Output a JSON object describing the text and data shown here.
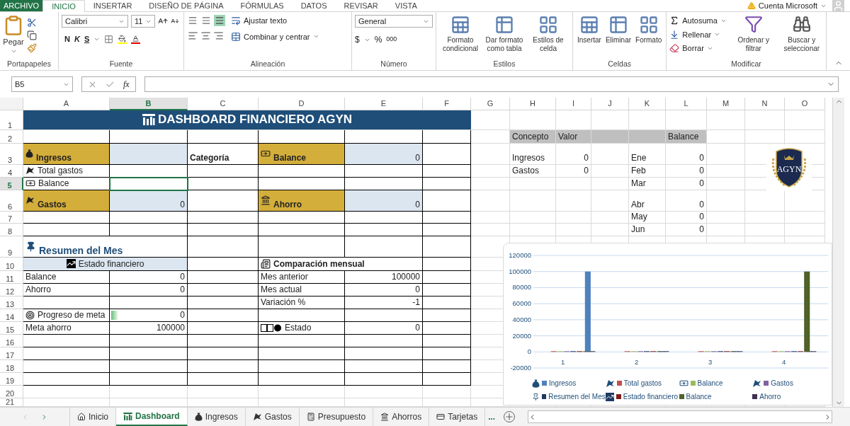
{
  "ribbon": {
    "tabs": [
      {
        "label": "ARCHIVO",
        "kind": "file",
        "selected": false
      },
      {
        "label": "INICIO",
        "kind": "tab",
        "selected": true
      },
      {
        "label": "INSERTAR",
        "kind": "tab",
        "selected": false
      },
      {
        "label": "DISEÑO DE PÁGINA",
        "kind": "tab",
        "selected": false
      },
      {
        "label": "FÓRMULAS",
        "kind": "tab",
        "selected": false
      },
      {
        "label": "DATOS",
        "kind": "tab",
        "selected": false
      },
      {
        "label": "REVISAR",
        "kind": "tab",
        "selected": false
      },
      {
        "label": "VISTA",
        "kind": "tab",
        "selected": false
      }
    ],
    "account": "Cuenta Microsoft",
    "groups": [
      {
        "kind": "clipboard",
        "name": "Portapapeles",
        "paste": "Pegar"
      },
      {
        "kind": "font",
        "name": "Fuente",
        "font": "Calibri",
        "size": "11",
        "bold": "N",
        "italic": "K",
        "underline": "S"
      },
      {
        "kind": "alignment",
        "name": "Alineación",
        "wrap": "Ajustar texto",
        "merge": "Combinar y centrar",
        "vertical": [
          {
            "selected": false
          },
          {
            "selected": false
          },
          {
            "selected": true
          }
        ]
      },
      {
        "kind": "number",
        "name": "Número",
        "format": "General",
        "currency": "$",
        "percent": "%",
        "thousands": "000"
      },
      {
        "kind": "large",
        "name": "Estilos",
        "buttons": [
          "Formato condicional",
          "Dar formato como tabla",
          "Estilos de celda"
        ]
      },
      {
        "kind": "large",
        "name": "Celdas",
        "buttons": [
          "Insertar",
          "Eliminar",
          "Formato"
        ]
      },
      {
        "kind": "editing",
        "name": "Modificar",
        "small": [
          "Autosuma",
          "Rellenar",
          "Borrar"
        ],
        "large": [
          "Ordenar y filtrar",
          "Buscar y seleccionar"
        ]
      }
    ]
  },
  "formula_bar": {
    "name_box": "B5",
    "function_label": "fx"
  },
  "sheet": {
    "columns": [
      {
        "label": "A",
        "selected": false
      },
      {
        "label": "B",
        "selected": true
      },
      {
        "label": "C",
        "selected": false
      },
      {
        "label": "D",
        "selected": false
      },
      {
        "label": "E",
        "selected": false
      },
      {
        "label": "F",
        "selected": false
      },
      {
        "label": "G",
        "selected": false
      },
      {
        "label": "H",
        "selected": false
      },
      {
        "label": "I",
        "selected": false
      },
      {
        "label": "J",
        "selected": false
      },
      {
        "label": "K",
        "selected": false
      },
      {
        "label": "L",
        "selected": false
      },
      {
        "label": "M",
        "selected": false
      },
      {
        "label": "N",
        "selected": false
      },
      {
        "label": "O",
        "selected": false
      }
    ],
    "rows": [
      {
        "label": "1",
        "selected": false,
        "cells": [
          {
            "kind": "title",
            "text": "DASHBOARD FINANCIERO AGYN"
          },
          {
            "kind": "merged"
          },
          {
            "kind": "merged"
          },
          {
            "kind": "merged"
          },
          {
            "kind": "merged"
          },
          {
            "kind": "merged"
          }
        ]
      },
      {
        "label": "2",
        "selected": false,
        "cells": [
          {
            "kind": "empty"
          },
          {
            "kind": "empty"
          },
          {
            "kind": "empty"
          },
          {
            "kind": "empty"
          },
          {
            "kind": "empty"
          },
          {
            "kind": "empty"
          },
          {
            "kind": "empty"
          },
          {
            "kind": "gray",
            "text": "Concepto"
          },
          {
            "kind": "gray",
            "text": "Valor"
          },
          {
            "kind": "gray"
          },
          {
            "kind": "gray"
          },
          {
            "kind": "gray",
            "text": "Balance"
          }
        ]
      },
      {
        "label": "3",
        "selected": false,
        "cells": [
          {
            "kind": "gold",
            "text": "Ingresos"
          },
          {
            "kind": "blue"
          },
          {
            "kind": "bold",
            "text": "Categoría"
          },
          {
            "kind": "gold",
            "text": "Balance"
          },
          {
            "kind": "blue",
            "text": "0"
          },
          {
            "kind": "empty"
          },
          {
            "kind": "empty"
          },
          {
            "kind": "label",
            "text": "Ingresos"
          },
          {
            "kind": "number",
            "text": "0"
          },
          {
            "kind": "empty"
          },
          {
            "kind": "label",
            "text": "Ene"
          },
          {
            "kind": "number",
            "text": "0"
          }
        ]
      },
      {
        "label": "4",
        "selected": false,
        "cells": [
          {
            "kind": "label",
            "text": "Total gastos"
          },
          {
            "kind": "empty"
          },
          {
            "kind": "empty"
          },
          {
            "kind": "empty"
          },
          {
            "kind": "empty"
          },
          {
            "kind": "empty"
          },
          {
            "kind": "empty"
          },
          {
            "kind": "label",
            "text": "Gastos"
          },
          {
            "kind": "number",
            "text": "0"
          },
          {
            "kind": "empty"
          },
          {
            "kind": "label",
            "text": "Feb"
          },
          {
            "kind": "number",
            "text": "0"
          }
        ]
      },
      {
        "label": "5",
        "selected": true,
        "cells": [
          {
            "kind": "label",
            "text": "Balance"
          },
          {
            "kind": "empty"
          },
          {
            "kind": "empty"
          },
          {
            "kind": "empty"
          },
          {
            "kind": "empty"
          },
          {
            "kind": "empty"
          },
          {
            "kind": "empty"
          },
          {
            "kind": "empty"
          },
          {
            "kind": "empty"
          },
          {
            "kind": "empty"
          },
          {
            "kind": "label",
            "text": "Mar"
          },
          {
            "kind": "number",
            "text": "0"
          }
        ]
      },
      {
        "label": "6",
        "selected": false,
        "cells": [
          {
            "kind": "gold",
            "text": "Gastos"
          },
          {
            "kind": "blue",
            "text": "0"
          },
          {
            "kind": "empty"
          },
          {
            "kind": "gold",
            "text": "Ahorro"
          },
          {
            "kind": "blue",
            "text": "0"
          },
          {
            "kind": "empty"
          },
          {
            "kind": "empty"
          },
          {
            "kind": "empty"
          },
          {
            "kind": "empty"
          },
          {
            "kind": "empty"
          },
          {
            "kind": "label",
            "text": "Abr"
          },
          {
            "kind": "number",
            "text": "0"
          }
        ]
      },
      {
        "label": "7",
        "selected": false,
        "cells": [
          {
            "kind": "empty"
          },
          {
            "kind": "empty"
          },
          {
            "kind": "empty"
          },
          {
            "kind": "empty"
          },
          {
            "kind": "empty"
          },
          {
            "kind": "empty"
          },
          {
            "kind": "empty"
          },
          {
            "kind": "empty"
          },
          {
            "kind": "empty"
          },
          {
            "kind": "empty"
          },
          {
            "kind": "label",
            "text": "May"
          },
          {
            "kind": "number",
            "text": "0"
          }
        ]
      },
      {
        "label": "8",
        "selected": false,
        "cells": [
          {
            "kind": "empty"
          },
          {
            "kind": "empty"
          },
          {
            "kind": "empty"
          },
          {
            "kind": "empty"
          },
          {
            "kind": "empty"
          },
          {
            "kind": "empty"
          },
          {
            "kind": "empty"
          },
          {
            "kind": "empty"
          },
          {
            "kind": "empty"
          },
          {
            "kind": "empty"
          },
          {
            "kind": "label",
            "text": "Jun"
          },
          {
            "kind": "number",
            "text": "0"
          }
        ]
      },
      {
        "label": "9",
        "selected": false,
        "cells": [
          {
            "kind": "section",
            "text": "Resumen del Mes"
          },
          {
            "kind": "merged"
          }
        ]
      },
      {
        "label": "10",
        "selected": false,
        "cells": [
          {
            "kind": "subheader",
            "text": "Estado financiero"
          },
          {
            "kind": "merged"
          },
          {
            "kind": "empty"
          },
          {
            "kind": "bold",
            "text": "Comparación mensual"
          },
          {
            "kind": "merged"
          }
        ]
      },
      {
        "label": "11",
        "selected": false,
        "cells": [
          {
            "kind": "label",
            "text": "Balance"
          },
          {
            "kind": "number",
            "text": "0"
          },
          {
            "kind": "empty"
          },
          {
            "kind": "label",
            "text": "Mes anterior"
          },
          {
            "kind": "number",
            "text": "100000"
          }
        ]
      },
      {
        "label": "12",
        "selected": false,
        "cells": [
          {
            "kind": "label",
            "text": "Ahorro"
          },
          {
            "kind": "number",
            "text": "0"
          },
          {
            "kind": "empty"
          },
          {
            "kind": "label",
            "text": "Mes actual"
          },
          {
            "kind": "number",
            "text": "0"
          }
        ]
      },
      {
        "label": "13",
        "selected": false,
        "cells": [
          {
            "kind": "empty"
          },
          {
            "kind": "empty"
          },
          {
            "kind": "empty"
          },
          {
            "kind": "label",
            "text": "Variación %"
          },
          {
            "kind": "number",
            "text": "-1"
          }
        ]
      },
      {
        "label": "14",
        "selected": false,
        "cells": [
          {
            "kind": "label",
            "text": "Progreso de meta"
          },
          {
            "kind": "databar",
            "text": "0",
            "level": 0
          }
        ]
      },
      {
        "label": "15",
        "selected": false,
        "cells": [
          {
            "kind": "label",
            "text": "Meta ahorro"
          },
          {
            "kind": "number",
            "text": "100000"
          },
          {
            "kind": "empty"
          },
          {
            "kind": "label",
            "text": "Estado"
          },
          {
            "kind": "number",
            "text": "0"
          }
        ]
      },
      {
        "label": "16",
        "selected": false
      },
      {
        "label": "17",
        "selected": false
      },
      {
        "label": "18",
        "selected": false
      },
      {
        "label": "19",
        "selected": false
      },
      {
        "label": "20",
        "selected": false
      },
      {
        "label": "21",
        "selected": false
      }
    ],
    "logo": {
      "text": "AGYN"
    },
    "chart": {
      "chart_data": {
        "type": "bar",
        "categories": [
          "1",
          "2",
          "3",
          "4"
        ],
        "series": [
          {
            "name": "Ingresos",
            "color": "#4f81bd",
            "values": [
              100000,
              0,
              0,
              0
            ]
          },
          {
            "name": "Total gastos",
            "color": "#c0504d",
            "values": [
              0,
              0,
              0,
              0
            ]
          },
          {
            "name": "Balance",
            "color": "#9bbb59",
            "values": [
              0,
              0,
              0,
              0
            ]
          },
          {
            "name": "Gastos",
            "color": "#8064a2",
            "values": [
              0,
              0,
              0,
              0
            ]
          },
          {
            "name": "Resumen del Mes",
            "color": "#1f3864",
            "values": [
              0,
              0,
              0,
              0
            ]
          },
          {
            "name": "Estado financiero",
            "color": "#7f1d1d",
            "values": [
              0,
              0,
              0,
              0
            ]
          },
          {
            "name": "Balance",
            "color": "#4f6228",
            "values": [
              0,
              0,
              0,
              100000
            ]
          },
          {
            "name": "Ahorro",
            "color": "#3f3151",
            "values": [
              0,
              0,
              0,
              0
            ]
          }
        ],
        "ylim": [
          -20000,
          120000
        ],
        "yticks": [
          -20000,
          0,
          20000,
          40000,
          60000,
          80000,
          100000,
          120000
        ],
        "grid": true,
        "legend": true
      }
    }
  },
  "sheet_tabs": {
    "tabs": [
      {
        "label": "Inicio",
        "selected": false
      },
      {
        "label": "Dashboard",
        "selected": true
      },
      {
        "label": "Ingresos",
        "selected": false
      },
      {
        "label": "Gastos",
        "selected": false
      },
      {
        "label": "Presupuesto",
        "selected": false
      },
      {
        "label": "Ahorros",
        "selected": false
      },
      {
        "label": "Tarjetas",
        "selected": false
      }
    ],
    "overflow": "..."
  }
}
